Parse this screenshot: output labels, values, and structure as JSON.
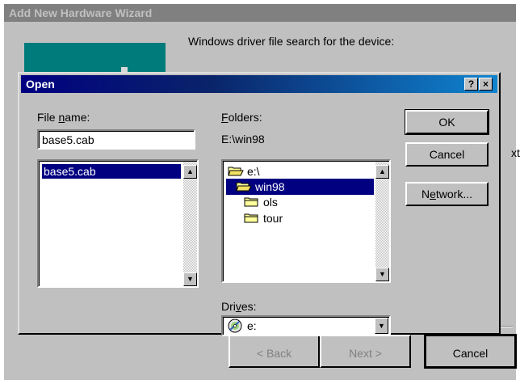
{
  "wizard": {
    "title": "Add New Hardware Wizard",
    "description": "Windows driver file search for the device:",
    "clipped_text": "xt",
    "buttons": {
      "back": "< Back",
      "next": "Next >",
      "cancel": "Cancel"
    }
  },
  "dialog": {
    "title": "Open",
    "title_buttons": {
      "help": "?",
      "close": "×"
    },
    "file_name": {
      "label_pre": "File ",
      "label_key": "n",
      "label_post": "ame:",
      "value": "base5.cab"
    },
    "file_list": [
      "base5.cab"
    ],
    "folders": {
      "label_key": "F",
      "label_post": "olders:",
      "current_path": "E:\\win98",
      "tree": [
        {
          "name": "e:\\",
          "icon": "open-folder-icon",
          "selected": false
        },
        {
          "name": "win98",
          "icon": "open-folder-icon",
          "selected": true
        },
        {
          "name": "ols",
          "icon": "folder-icon",
          "selected": false
        },
        {
          "name": "tour",
          "icon": "folder-icon",
          "selected": false
        }
      ]
    },
    "drives": {
      "label_pre": "Dri",
      "label_key": "v",
      "label_post": "es:",
      "value": "e:",
      "icon": "cd-drive-icon"
    },
    "buttons": {
      "ok": "OK",
      "cancel": "Cancel",
      "network_pre": "N",
      "network_key": "e",
      "network_post": "twork..."
    }
  }
}
